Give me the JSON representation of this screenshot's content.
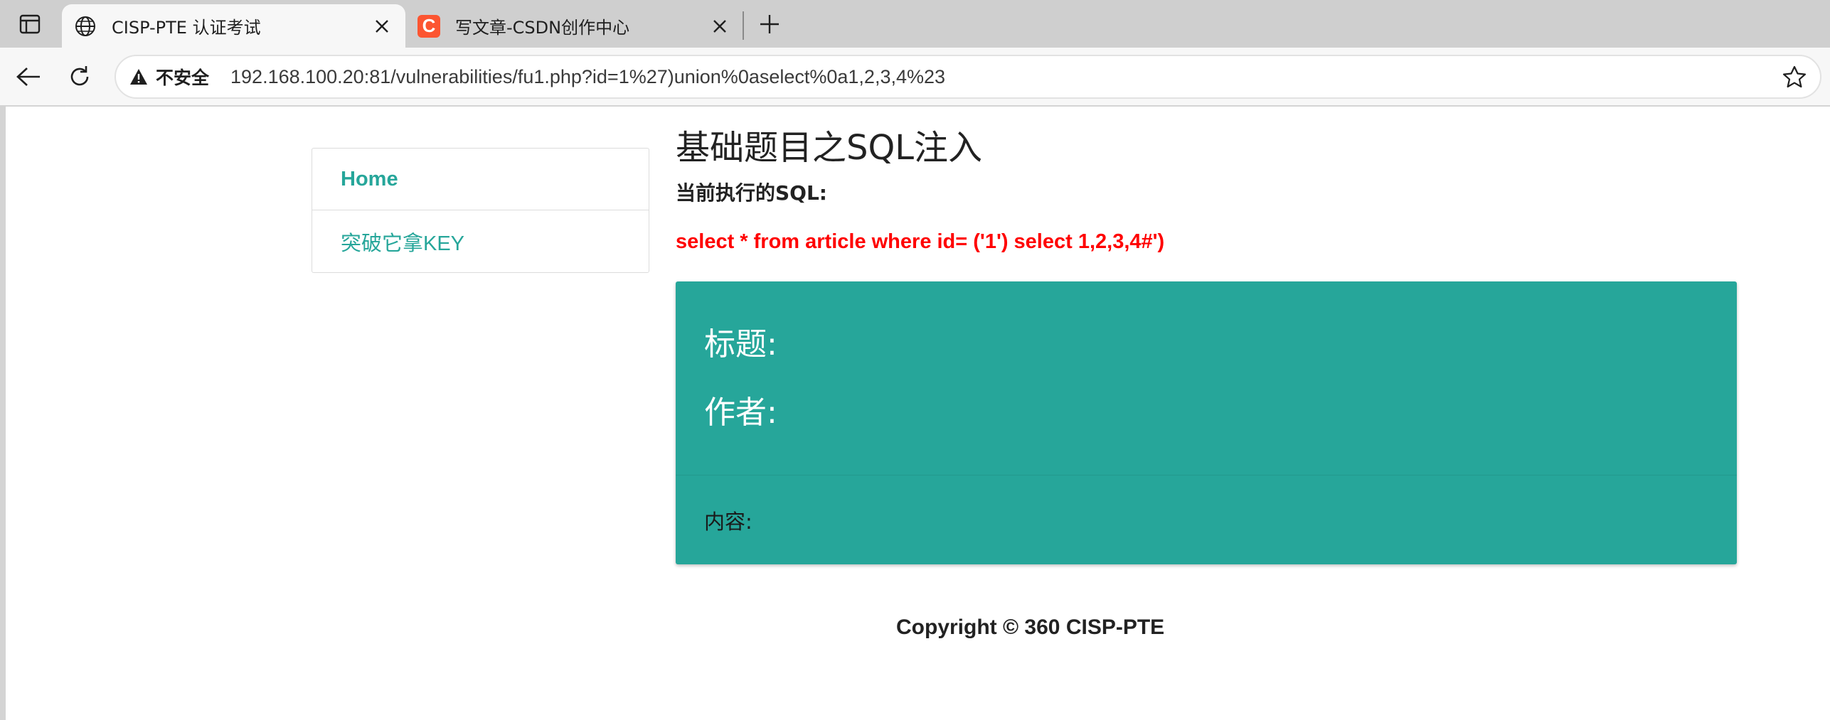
{
  "tabs": [
    {
      "title": "CISP-PTE 认证考试",
      "active": true,
      "icon": "globe-icon"
    },
    {
      "title": "写文章-CSDN创作中心",
      "active": false,
      "icon": "csdn-favicon",
      "favicon_letter": "C"
    }
  ],
  "toolbar": {
    "security_label": "不安全",
    "url": "192.168.100.20:81/vulnerabilities/fu1.php?id=1%27)union%0aselect%0a1,2,3,4%23"
  },
  "page": {
    "title": "基础题目之SQL注入",
    "sql_label": "当前执行的SQL:",
    "sql_query": "select * from article where id= ('1') select 1,2,3,4#')",
    "nav": {
      "home": "Home",
      "key": "突破它拿KEY"
    },
    "card": {
      "title_label": "标题:",
      "author_label": "作者:",
      "content_label": "内容:"
    },
    "footer": "Copyright © 360 CISP-PTE"
  },
  "colors": {
    "accent": "#26a69a",
    "sql": "#ff0000",
    "csdn": "#fc5531"
  }
}
